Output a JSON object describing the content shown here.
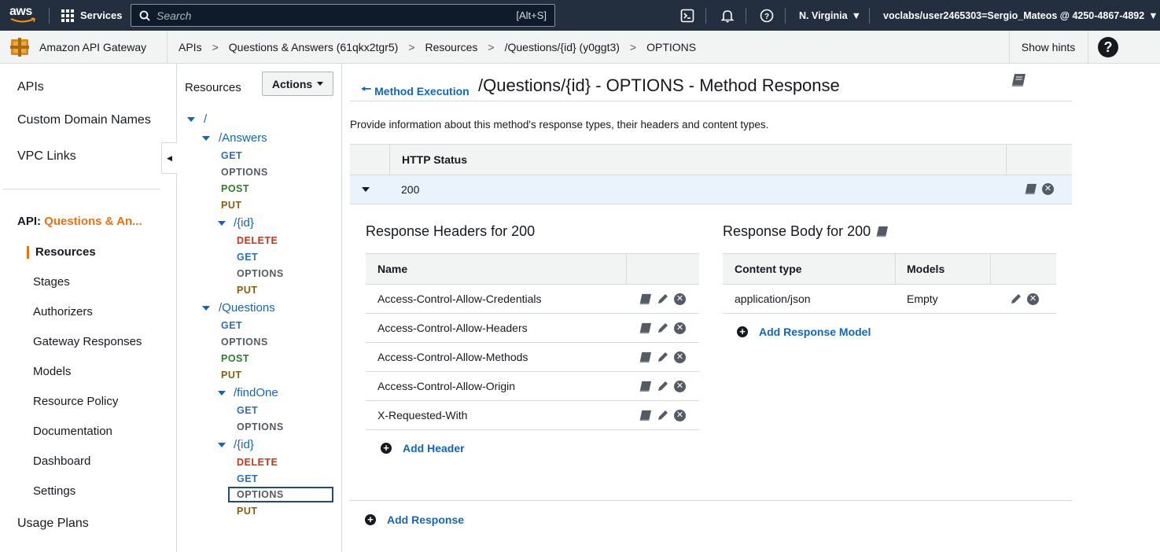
{
  "topnav": {
    "logo": "aws",
    "services_label": "Services",
    "search_placeholder": "Search",
    "search_shortcut": "[Alt+S]",
    "region": "N. Virginia",
    "account": "voclabs/user2465303=Sergio_Mateos @ 4250-4867-4892",
    "icons": [
      "cloudshell-icon",
      "bell-icon",
      "help-icon"
    ]
  },
  "crumbbar": {
    "service_name": "Amazon API Gateway",
    "crumbs": [
      "APIs",
      "Questions & Answers (61qkx2tgr5)",
      "Resources",
      "/Questions/{id} (y0ggt3)",
      "OPTIONS"
    ],
    "show_hints": "Show hints",
    "help": "?"
  },
  "leftnav": {
    "apis": "APIs",
    "custom_domains": "Custom Domain Names",
    "vpc_links": "VPC Links",
    "api_prefix": "API:",
    "api_name": "Questions & An...",
    "sub_items": [
      "Resources",
      "Stages",
      "Authorizers",
      "Gateway Responses",
      "Models",
      "Resource Policy",
      "Documentation",
      "Dashboard",
      "Settings"
    ],
    "usage_plans": "Usage Plans"
  },
  "tree": {
    "title": "Resources",
    "actions": "Actions",
    "root": "/",
    "answers": "/Answers",
    "answers_methods": [
      "GET",
      "OPTIONS",
      "POST",
      "PUT"
    ],
    "answers_id": "/{id}",
    "answers_id_methods": [
      "DELETE",
      "GET",
      "OPTIONS",
      "PUT"
    ],
    "questions": "/Questions",
    "questions_methods": [
      "GET",
      "OPTIONS",
      "POST",
      "PUT"
    ],
    "findone": "/findOne",
    "findone_methods": [
      "GET",
      "OPTIONS"
    ],
    "questions_id": "/{id}",
    "questions_id_methods": [
      "DELETE",
      "GET",
      "OPTIONS",
      "PUT"
    ]
  },
  "main": {
    "back_link": "Method Execution",
    "title": "/Questions/{id} - OPTIONS - Method Response",
    "description": "Provide information about this method's response types, their headers and content types.",
    "status_header": "HTTP Status",
    "status_code": "200",
    "headers_title": "Response Headers for 200",
    "headers_col": "Name",
    "headers": [
      "Access-Control-Allow-Credentials",
      "Access-Control-Allow-Headers",
      "Access-Control-Allow-Methods",
      "Access-Control-Allow-Origin",
      "X-Requested-With"
    ],
    "add_header": "Add Header",
    "body_title": "Response Body for 200",
    "body_cols": [
      "Content type",
      "Models"
    ],
    "body_rows": [
      {
        "content_type": "application/json",
        "model": "Empty"
      }
    ],
    "add_model": "Add Response Model",
    "add_response": "Add Response"
  },
  "colors": {
    "nav_bg": "#232f3e",
    "accent_orange": "#ec7211",
    "link_blue": "#1166bb",
    "method_get": "#2e6eb5",
    "method_post": "#2d7d2d",
    "method_put": "#8c5a0f",
    "method_delete": "#d13212"
  }
}
